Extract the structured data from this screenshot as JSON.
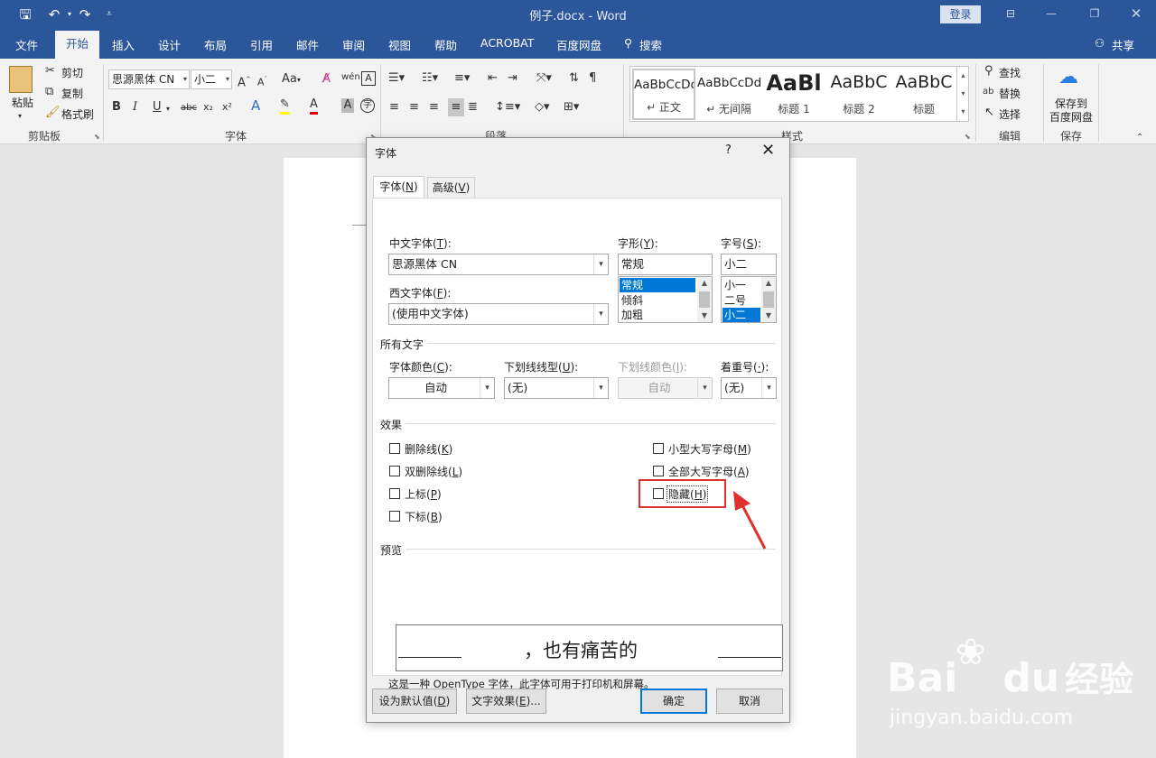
{
  "titlebar": {
    "doc_title": "例子.docx  -  Word",
    "login_label": "登录"
  },
  "ribbon_tabs": [
    "文件",
    "开始",
    "插入",
    "设计",
    "布局",
    "引用",
    "邮件",
    "审阅",
    "视图",
    "帮助",
    "ACROBAT",
    "百度网盘",
    "搜索"
  ],
  "share_label": "共享",
  "clipboard": {
    "paste": "粘贴",
    "cut": "剪切",
    "copy": "复制",
    "format_painter": "格式刷",
    "group": "剪贴板"
  },
  "font_group": {
    "font_name": "思源黑体 CN",
    "font_size": "小二",
    "change_case": "Aa",
    "bold": "B",
    "italic": "I",
    "underline": "U",
    "strike": "abc",
    "subscript": "x₂",
    "superscript": "x²",
    "group": "字体"
  },
  "paragraph_group": {
    "group": "段落"
  },
  "styles_group": {
    "items": [
      {
        "sample": "AaBbCcDd",
        "name": "↵ 正文"
      },
      {
        "sample": "AaBbCcDd",
        "name": "↵ 无间隔"
      },
      {
        "sample": "AaBl",
        "name": "标题 1"
      },
      {
        "sample": "AaBbC",
        "name": "标题 2"
      },
      {
        "sample": "AaBbC",
        "name": "标题"
      }
    ],
    "group": "样式"
  },
  "editing_group": {
    "find": "查找",
    "replace": "替换",
    "select": "选择",
    "group": "编辑"
  },
  "save_group": {
    "save_to": "保存到",
    "baidu": "百度网盘",
    "group": "保存"
  },
  "dialog": {
    "title": "字体",
    "help": "?",
    "tabs": [
      {
        "label": "字体",
        "key": "N"
      },
      {
        "label": "高级",
        "key": "V"
      }
    ],
    "cn_font": {
      "label": "中文字体",
      "key": "T",
      "value": "思源黑体 CN"
    },
    "west_font": {
      "label": "西文字体",
      "key": "F",
      "value": "(使用中文字体)"
    },
    "style": {
      "label": "字形",
      "key": "Y",
      "value": "常规",
      "options": [
        "常规",
        "倾斜",
        "加粗"
      ]
    },
    "size": {
      "label": "字号",
      "key": "S",
      "value": "小二",
      "options": [
        "小一",
        "二号",
        "小二"
      ]
    },
    "all_text": "所有文字",
    "font_color": {
      "label": "字体颜色",
      "key": "C",
      "value": "自动"
    },
    "underline_style": {
      "label": "下划线线型",
      "key": "U",
      "value": "(无)"
    },
    "underline_color": {
      "label": "下划线颜色",
      "key": "I",
      "value": "自动"
    },
    "emphasis": {
      "label": "着重号",
      "key": "·",
      "value": "(无)"
    },
    "effects": "效果",
    "effects_left": [
      {
        "label": "删除线",
        "key": "K"
      },
      {
        "label": "双删除线",
        "key": "L"
      },
      {
        "label": "上标",
        "key": "P"
      },
      {
        "label": "下标",
        "key": "B"
      }
    ],
    "effects_right": [
      {
        "label": "小型大写字母",
        "key": "M"
      },
      {
        "label": "全部大写字母",
        "key": "A"
      },
      {
        "label": "隐藏",
        "key": "H"
      }
    ],
    "preview": "预览",
    "preview_text": "，也有痛苦的",
    "preview_note": "这是一种 OpenType 字体，此字体可用于打印机和屏幕。",
    "set_default": {
      "label": "设为默认值",
      "key": "D"
    },
    "text_effects": {
      "label": "文字效果",
      "key": "E"
    },
    "ok": "确定",
    "cancel": "取消"
  },
  "watermark": {
    "brand": "Bai",
    "brand2": "du",
    "cn": "经验",
    "url": "jingyan.baidu.com"
  },
  "colors": {
    "word_blue": "#2b579a",
    "selection": "#0078d7",
    "highlight": "#e03131"
  }
}
